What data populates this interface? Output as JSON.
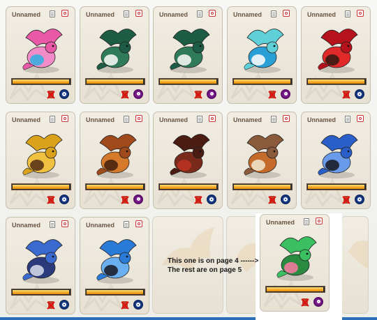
{
  "dragons": [
    {
      "name": "Unnamed",
      "gender": "male",
      "energy": 0.97,
      "colors": [
        "#e85aa8",
        "#3aaee0",
        "#f28cc8"
      ]
    },
    {
      "name": "Unnamed",
      "gender": "female",
      "energy": 0.97,
      "colors": [
        "#1d5d45",
        "#f4f4f4",
        "#2f7a58"
      ]
    },
    {
      "name": "Unnamed",
      "gender": "female",
      "energy": 0.97,
      "colors": [
        "#1d5d45",
        "#f4f4f4",
        "#2f7a58"
      ]
    },
    {
      "name": "Unnamed",
      "gender": "female",
      "energy": 0.97,
      "colors": [
        "#5fd0d8",
        "#f4f8f8",
        "#2a9fd6"
      ]
    },
    {
      "name": "Unnamed",
      "gender": "male",
      "energy": 0.97,
      "colors": [
        "#b5121b",
        "#3b1a12",
        "#e02a2a"
      ]
    },
    {
      "name": "Unnamed",
      "gender": "male",
      "energy": 0.97,
      "colors": [
        "#d9a21a",
        "#5b3418",
        "#f0c040"
      ]
    },
    {
      "name": "Unnamed",
      "gender": "female",
      "energy": 0.97,
      "colors": [
        "#a04a1c",
        "#4a2410",
        "#d47a2a"
      ]
    },
    {
      "name": "Unnamed",
      "gender": "male",
      "energy": 0.97,
      "colors": [
        "#4a1c12",
        "#b83222",
        "#7a2a1a"
      ]
    },
    {
      "name": "Unnamed",
      "gender": "male",
      "energy": 0.97,
      "colors": [
        "#8a5a3a",
        "#f0e2c8",
        "#c46a2a"
      ]
    },
    {
      "name": "Unnamed",
      "gender": "male",
      "energy": 0.97,
      "colors": [
        "#2a5ec8",
        "#1b1f2a",
        "#6a9aea"
      ]
    },
    {
      "name": "Unnamed",
      "gender": "male",
      "energy": 0.97,
      "colors": [
        "#3a6ad0",
        "#cfd6e6",
        "#2a3a7a"
      ]
    },
    {
      "name": "Unnamed",
      "gender": "male",
      "energy": 0.97,
      "colors": [
        "#2a7ad8",
        "#1c2030",
        "#6ab0f0"
      ]
    },
    {
      "name": "Unnamed",
      "gender": "female",
      "energy": 0.97,
      "colors": [
        "#3ac060",
        "#f27aa0",
        "#2a8a40"
      ]
    }
  ],
  "annotation": {
    "line1": "This one is on page 4 ------>",
    "line2": "The rest are on page 5"
  }
}
